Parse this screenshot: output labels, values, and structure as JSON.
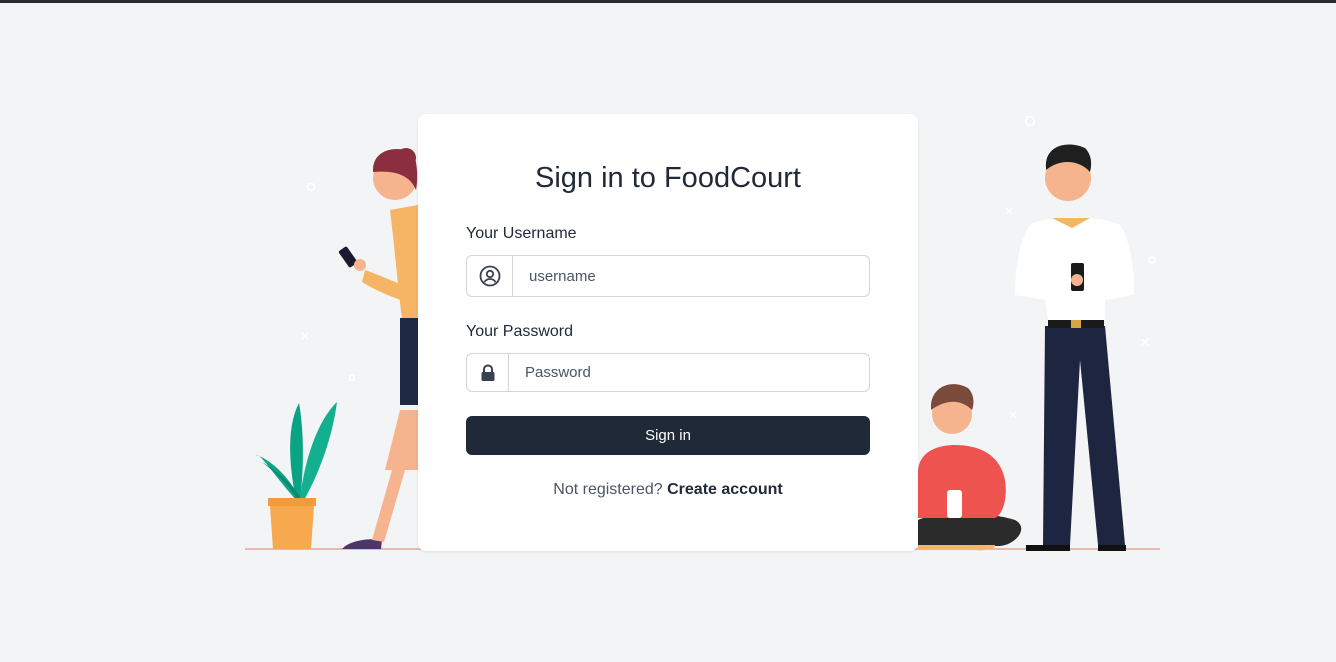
{
  "form": {
    "title": "Sign in to FoodCourt",
    "username_label": "Your Username",
    "username_placeholder": "username",
    "password_label": "Your Password",
    "password_placeholder": "Password",
    "submit_label": "Sign in",
    "footer_text": "Not registered?",
    "footer_link": "Create account"
  },
  "icons": {
    "username": "user-circle-icon",
    "password": "lock-icon"
  },
  "colors": {
    "background": "#f3f4f6",
    "card": "#ffffff",
    "button": "#1f2937",
    "text_dark": "#1f2937",
    "text_muted": "#4b5563"
  }
}
